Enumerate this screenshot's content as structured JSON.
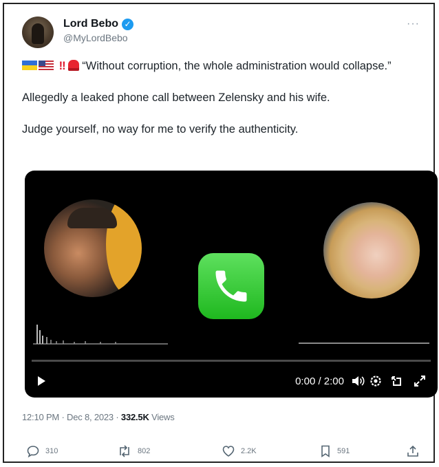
{
  "author": {
    "display_name": "Lord Bebo",
    "handle": "@MyLordBebo",
    "verified_icon": "✓"
  },
  "more_label": "···",
  "tweet": {
    "quote": "“Without corruption, the whole administration would collapse.”",
    "bang": "!!",
    "line2": "Allegedly a leaked phone call between Zelensky and his wife.",
    "line3": "Judge yourself, no way for me to verify the authenticity."
  },
  "player": {
    "time": "0:00 / 2:00",
    "progress": 0
  },
  "meta": {
    "time": "12:10 PM",
    "separator": "·",
    "date": "Dec 8, 2023",
    "views_count": "332.5K",
    "views_label": "Views"
  },
  "actions": {
    "replies": "310",
    "reposts": "802",
    "likes": "2.2K",
    "bookmarks": "591"
  },
  "colors": {
    "verified": "#1d9bf0",
    "call_green": "#2ecc40",
    "text": "#0f1419",
    "muted": "#6b7680"
  }
}
